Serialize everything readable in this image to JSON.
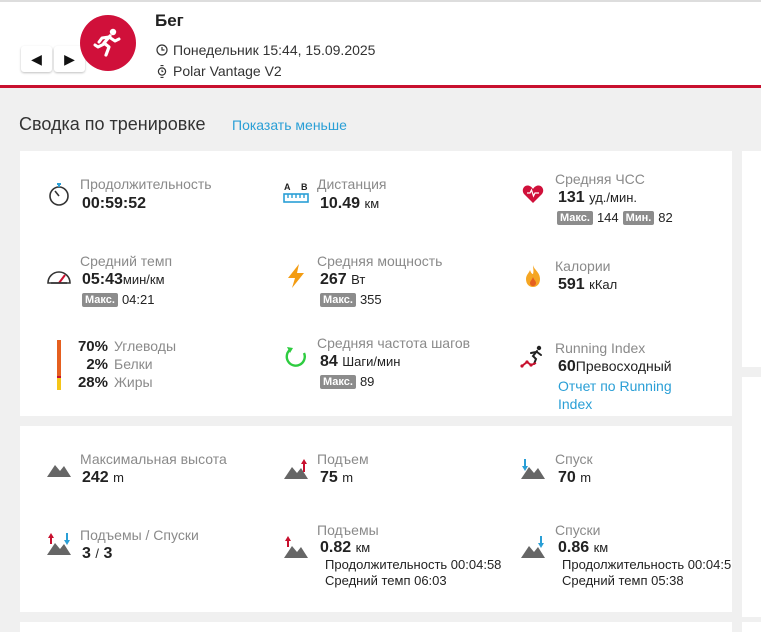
{
  "header": {
    "prev_label": "◀",
    "next_label": "▶",
    "title": "Бег",
    "datetime": "Понедельник 15:44, 15.09.2025",
    "device": "Polar Vantage V2",
    "accent_color": "#c8102e"
  },
  "summary": {
    "title": "Сводка по тренировке",
    "show_less": "Показать меньше"
  },
  "metrics": {
    "duration": {
      "label": "Продолжительность",
      "value": "00:59:52",
      "icon": "stopwatch-icon"
    },
    "distance": {
      "label": "Дистанция",
      "value": "10.49",
      "unit": "км",
      "icon": "distance-icon",
      "a": "A",
      "b": "B"
    },
    "avg_hr": {
      "label": "Средняя ЧСС",
      "value": "131",
      "unit": "уд./мин.",
      "max_label": "Макс.",
      "max_value": "144",
      "min_label": "Мин.",
      "min_value": "82",
      "icon": "heart-icon"
    },
    "avg_pace": {
      "label": "Средний темп",
      "value": "05:43",
      "unit": "мин/км",
      "max_label": "Макс.",
      "max_value": "04:21",
      "icon": "speedometer-icon"
    },
    "avg_power": {
      "label": "Средняя мощность",
      "value": "267",
      "unit": "Вт",
      "max_label": "Макс.",
      "max_value": "355",
      "icon": "lightning-icon"
    },
    "calories": {
      "label": "Калории",
      "value": "591",
      "unit": "кКал",
      "icon": "flame-icon"
    },
    "macros": [
      {
        "pct": "70%",
        "name": "Углеводы",
        "color": "#e55f1f"
      },
      {
        "pct": "2%",
        "name": "Белки",
        "color": "#c8102e"
      },
      {
        "pct": "28%",
        "name": "Жиры",
        "color": "#f5c518"
      }
    ],
    "cadence": {
      "label": "Средняя частота шагов",
      "value": "84",
      "unit": "Шаги/мин",
      "max_label": "Макс.",
      "max_value": "89",
      "icon": "cadence-icon"
    },
    "running_index": {
      "label": "Running Index",
      "value": "60",
      "rating": "Превосходный",
      "link_line1": "Отчет по Running",
      "link_line2": "Index",
      "icon": "running-index-icon"
    }
  },
  "altitude": {
    "max_altitude": {
      "label": "Максимальная высота",
      "value": "242",
      "unit": "m"
    },
    "ascent": {
      "label": "Подъем",
      "value": "75",
      "unit": "m"
    },
    "descent": {
      "label": "Спуск",
      "value": "70",
      "unit": "m"
    },
    "ups_downs": {
      "label": "Подъемы / Спуски",
      "value_up": "3",
      "sep": "/",
      "value_down": "3"
    },
    "uphills": {
      "label": "Подъемы",
      "value": "0.82",
      "unit": "км",
      "duration": "Продолжительность 00:04:58",
      "pace": "Средний темп 06:03"
    },
    "downhills": {
      "label": "Спуски",
      "value": "0.86",
      "unit": "км",
      "duration": "Продолжительность 00:04:5",
      "pace": "Средний темп 05:38"
    }
  }
}
